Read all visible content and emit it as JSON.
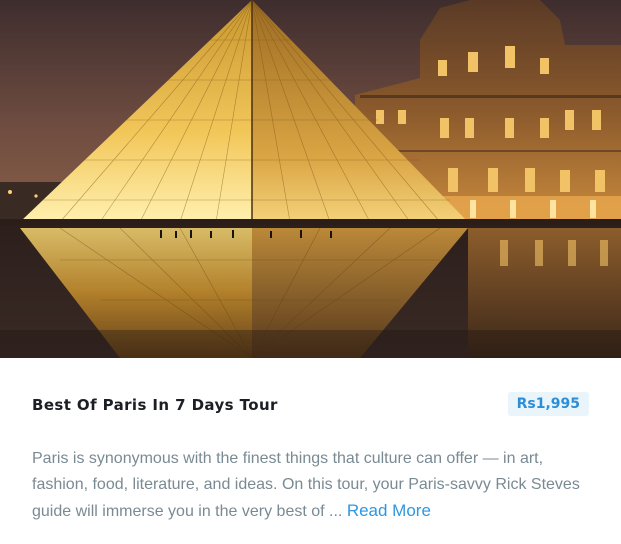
{
  "card": {
    "image_alt": "Louvre Pyramid, Paris",
    "title": "Best Of Paris In 7 Days Tour",
    "price": "Rs1,995",
    "description": "Paris is synonymous with the finest things that culture can offer — in art, fashion, food, literature, and ideas. On this tour, your Paris-savvy Rick Steves guide will immerse you in the very best of ...",
    "read_more": "Read More",
    "colors": {
      "title": "#1b1f24",
      "price_text": "#2b8ed6",
      "price_bg": "#eaf4fb",
      "description": "#7a8a93",
      "link": "#2f97e0"
    }
  }
}
